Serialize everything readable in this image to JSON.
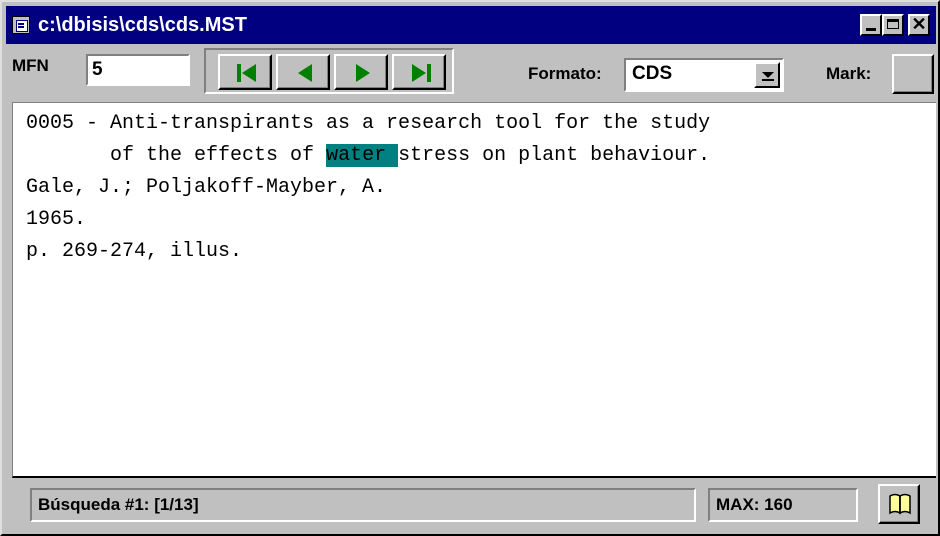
{
  "window": {
    "title": "c:\\dbisis\\cds\\cds.MST",
    "title_bar_color": "#000080",
    "system_icon": "window-menu-icon",
    "controls": [
      "minimize-icon",
      "maximize-icon",
      "close-icon"
    ]
  },
  "toolbar": {
    "mfn_label": "MFN",
    "mfn_value": "5",
    "nav_buttons": [
      {
        "name": "first-record",
        "icon": "first-arrow-icon"
      },
      {
        "name": "previous-record",
        "icon": "left-arrow-icon"
      },
      {
        "name": "next-record",
        "icon": "right-arrow-icon"
      },
      {
        "name": "last-record",
        "icon": "last-arrow-icon"
      }
    ],
    "nav_arrow_color": "#008000",
    "formato_label": "Formato:",
    "formato_value": "CDS",
    "mark_label": "Mark:"
  },
  "record": {
    "line1": "0005 - Anti-transpirants as a research tool for the study",
    "line2_before": "       of the effects of ",
    "line2_highlight": "water ",
    "line2_after": "stress on plant behaviour.",
    "line3": "Gale, J.; Poljakoff-Mayber, A.",
    "line4": "1965.",
    "line5": "p. 269-274, illus.",
    "highlight_color": "#008080"
  },
  "status": {
    "search": "Búsqueda #1: [1/13]",
    "max": "MAX: 160",
    "book_icon": "book-icon"
  }
}
